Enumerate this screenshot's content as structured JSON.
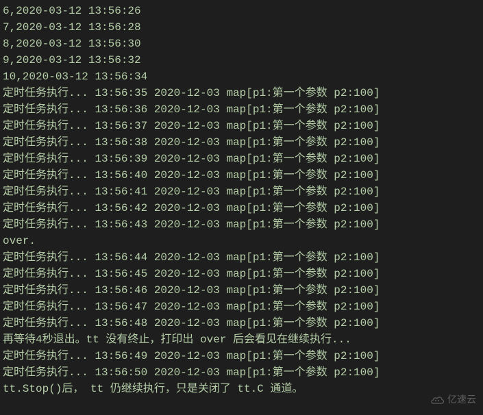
{
  "terminal": {
    "lines": [
      "6,2020-03-12 13:56:26",
      "7,2020-03-12 13:56:28",
      "8,2020-03-12 13:56:30",
      "9,2020-03-12 13:56:32",
      "10,2020-03-12 13:56:34",
      "定时任务执行... 13:56:35 2020-12-03 map[p1:第一个参数 p2:100]",
      "定时任务执行... 13:56:36 2020-12-03 map[p1:第一个参数 p2:100]",
      "定时任务执行... 13:56:37 2020-12-03 map[p1:第一个参数 p2:100]",
      "定时任务执行... 13:56:38 2020-12-03 map[p1:第一个参数 p2:100]",
      "定时任务执行... 13:56:39 2020-12-03 map[p1:第一个参数 p2:100]",
      "定时任务执行... 13:56:40 2020-12-03 map[p1:第一个参数 p2:100]",
      "定时任务执行... 13:56:41 2020-12-03 map[p1:第一个参数 p2:100]",
      "定时任务执行... 13:56:42 2020-12-03 map[p1:第一个参数 p2:100]",
      "定时任务执行... 13:56:43 2020-12-03 map[p1:第一个参数 p2:100]",
      "over.",
      "定时任务执行... 13:56:44 2020-12-03 map[p1:第一个参数 p2:100]",
      "定时任务执行... 13:56:45 2020-12-03 map[p1:第一个参数 p2:100]",
      "定时任务执行... 13:56:46 2020-12-03 map[p1:第一个参数 p2:100]",
      "定时任务执行... 13:56:47 2020-12-03 map[p1:第一个参数 p2:100]",
      "定时任务执行... 13:56:48 2020-12-03 map[p1:第一个参数 p2:100]",
      "再等待4秒退出。tt 没有终止，打印出 over 后会看见在继续执行...",
      "定时任务执行... 13:56:49 2020-12-03 map[p1:第一个参数 p2:100]",
      "定时任务执行... 13:56:50 2020-12-03 map[p1:第一个参数 p2:100]",
      "tt.Stop()后， tt 仍继续执行，只是关闭了 tt.C 通道。"
    ]
  },
  "watermark": {
    "text": "亿速云"
  }
}
